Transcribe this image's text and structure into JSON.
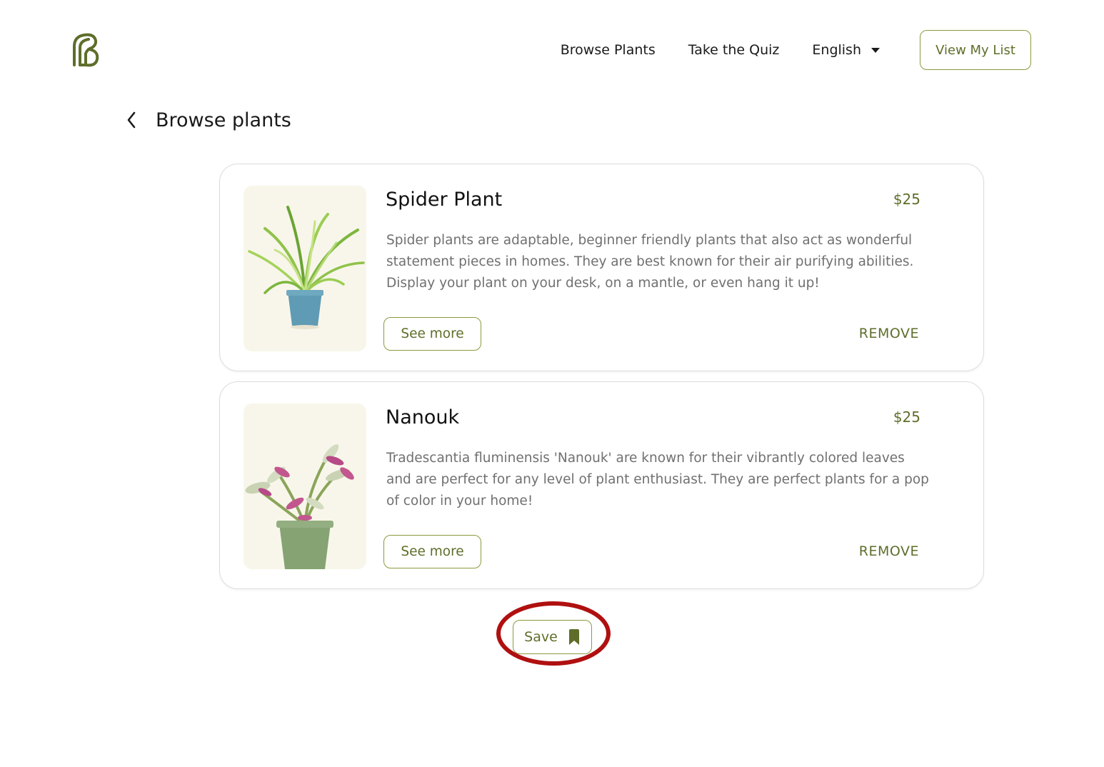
{
  "header": {
    "logo_icon": "leaf-b-logo-icon",
    "nav": {
      "browse_plants": "Browse Plants",
      "take_quiz": "Take the Quiz",
      "language": "English",
      "view_my_list": "View My List"
    }
  },
  "page": {
    "back_icon": "chevron-left-icon",
    "title": "Browse plants"
  },
  "plants": [
    {
      "name": "Spider Plant",
      "price": "$25",
      "description": "Spider plants are adaptable, beginner friendly plants that also act as wonderful statement pieces in homes. They are best known for their air purifying abilities. Display your plant on your desk, on a mantle, or even hang it up!",
      "see_more": "See more",
      "remove": "REMOVE"
    },
    {
      "name": "Nanouk",
      "price": "$25",
      "description": "Tradescantia fluminensis 'Nanouk' are known for their vibrantly colored leaves and are perfect for any level of plant enthusiast. They are perfect plants for a pop of color in your home!",
      "see_more": "See more",
      "remove": "REMOVE"
    }
  ],
  "save": {
    "label": "Save",
    "icon": "bookmark-icon"
  },
  "colors": {
    "accent": "#5e6e2a",
    "border_accent": "#8a9a3e",
    "image_bg": "#f8f6ea",
    "highlight": "#b01010"
  }
}
